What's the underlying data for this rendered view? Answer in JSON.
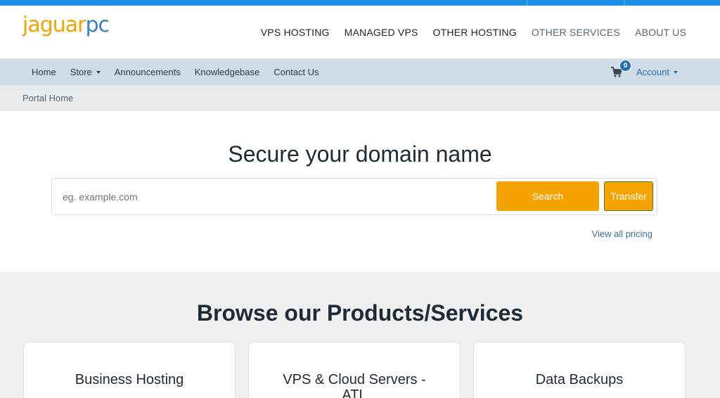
{
  "brand": {
    "logo_part1": "jaguar",
    "logo_part2": "pc",
    "accent": "#f5a300",
    "brand_blue": "#3d7fc4",
    "top_stripe": "#1a8fe3"
  },
  "main_nav": [
    {
      "label": "VPS HOSTING"
    },
    {
      "label": "MANAGED VPS"
    },
    {
      "label": "OTHER HOSTING"
    },
    {
      "label": "OTHER SERVICES"
    },
    {
      "label": "ABOUT US"
    }
  ],
  "sub_nav": {
    "items": [
      {
        "label": "Home"
      },
      {
        "label": "Store"
      },
      {
        "label": "Announcements"
      },
      {
        "label": "Knowledgebase"
      },
      {
        "label": "Contact Us"
      }
    ],
    "cart_icon": "shopping-cart-icon",
    "cart_count": "0",
    "account_label": "Account"
  },
  "breadcrumb": {
    "current": "Portal Home"
  },
  "domain_search": {
    "title": "Secure your domain name",
    "placeholder": "eg. example.com",
    "value": "",
    "search_label": "Search",
    "transfer_label": "Transfer",
    "pricing_link": "View all pricing"
  },
  "products": {
    "title": "Browse our Products/Services",
    "cards": [
      {
        "title": "Business Hosting"
      },
      {
        "title": "VPS & Cloud Servers - ATL"
      },
      {
        "title": "Data Backups"
      }
    ]
  }
}
